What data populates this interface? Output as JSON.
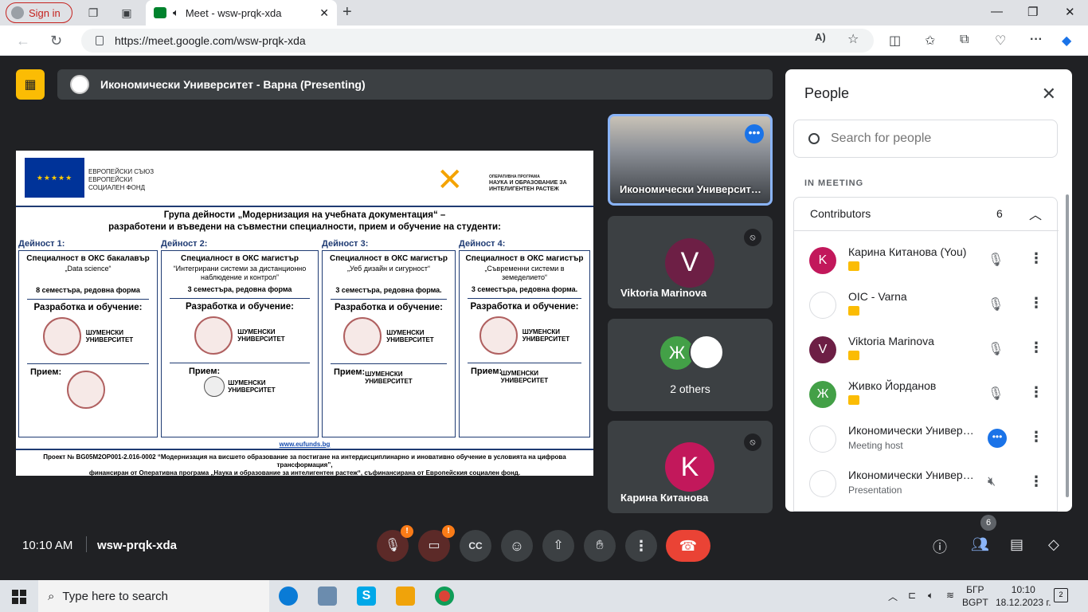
{
  "browser": {
    "signin_label": "Sign in",
    "tab_title": "Meet - wsw-prqk-xda",
    "url": "https://meet.google.com/wsw-prqk-xda"
  },
  "presenting_bar": {
    "label": "Икономически Университет - Варна (Presenting)"
  },
  "slide": {
    "eu_text_1": "ЕВРОПЕЙСКИ СЪЮЗ",
    "eu_text_2": "ЕВРОПЕЙСКИ",
    "eu_text_3": "СОЦИАЛЕН ФОНД",
    "op_text_1": "ОПЕРАТИВНА ПРОГРАМА",
    "op_text_2": "НАУКА И ОБРАЗОВАНИЕ ЗА",
    "op_text_3": "ИНТЕЛИГЕНТЕН РАСТЕЖ",
    "title_1": "Група дейности „Модернизация на учебната документация“ –",
    "title_2": "разработени и въведени на съвместни специалности, прием и обучение на студенти:",
    "columns": [
      {
        "caption": "Дейност 1:",
        "heading": "Специалност в ОКС бакалавър",
        "subject": "„Data science“",
        "semesters": "8 семестъра, редовна форма",
        "dev": "Разработка и обучение:",
        "intake": "Прием:"
      },
      {
        "caption": "Дейност 2:",
        "heading": "Специалност в ОКС магистър",
        "subject": "“Интегрирани системи за дистанционно наблюдение и контрол”",
        "semesters": "3 семестъра, редовна форма",
        "dev": "Разработка и обучение:",
        "intake": "Прием:"
      },
      {
        "caption": "Дейност 3:",
        "heading": "Специалност в ОКС магистър",
        "subject": "„Уеб дизайн и сигурност“",
        "semesters": "3 семестъра, редовна форма.",
        "dev": "Разработка и обучение:",
        "intake": "Прием:"
      },
      {
        "caption": "Дейност 4:",
        "heading": "Специалност в ОКС магистър",
        "subject": "„Съвременни системи в земеделието“",
        "semesters": "3 семестъра, редовна форма.",
        "dev": "Разработка и обучение:",
        "intake": "Прием:"
      }
    ],
    "shumen_1": "ШУМЕНСКИ",
    "shumen_2": "УНИВЕРСИТЕТ",
    "footer_url": "www.eufunds.bg",
    "footer_1": "Проект № BG05M2OP001-2.016-0002 “Модернизация на висшето образование за постигане на интердисциплинарно и иновативно обучение в условията на цифрова трансформация”,",
    "footer_2": "финансиран от Оперативна програма „Наука и образование за интелигентен растеж“, съфинансирана от Европейския социален фонд."
  },
  "tiles": [
    {
      "name": "Икономически Университет - Варна"
    },
    {
      "name": "Viktoria Marinova",
      "initial": "V"
    },
    {
      "name": "2 others",
      "initial": "Ж"
    },
    {
      "name": "Карина Китанова",
      "initial": "K"
    }
  ],
  "people_panel": {
    "title": "People",
    "search_placeholder": "Search for people",
    "section": "IN MEETING",
    "group": "Contributors",
    "count": "6",
    "people": [
      {
        "name": "Карина Китанова (You)",
        "initial": "K",
        "color": "#c2185b",
        "role": ""
      },
      {
        "name": "OIC - Varna",
        "initial": "",
        "color": "#ffffff",
        "role": ""
      },
      {
        "name": "Viktoria Marinova",
        "initial": "V",
        "color": "#6d1f45",
        "role": ""
      },
      {
        "name": "Живко Йорданов",
        "initial": "Ж",
        "color": "#43a047",
        "role": ""
      },
      {
        "name": "Икономически Университет - Варна",
        "initial": "",
        "color": "#ffffff",
        "role": "Meeting host"
      },
      {
        "name": "Икономически Университет - Варна",
        "initial": "",
        "color": "#ffffff",
        "role": "Presentation"
      }
    ]
  },
  "controls": {
    "time": "10:10 AM",
    "meeting_code": "wsw-prqk-xda",
    "people_badge": "6",
    "warn_glyph": "!"
  },
  "taskbar": {
    "search_placeholder": "Type here to search",
    "lang_1": "БГР",
    "lang_2": "BGPT",
    "clock_time": "10:10",
    "clock_date": "18.12.2023 г.",
    "notifications": "2"
  },
  "colors": {
    "accent": "#1a73e8",
    "end_call": "#ea4335",
    "presenting": "#fbbc04"
  }
}
